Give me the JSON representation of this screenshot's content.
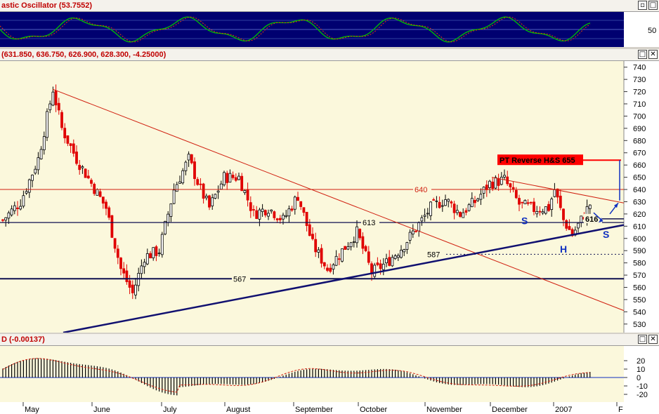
{
  "panels": {
    "stochastic": {
      "title": "astic Oscillator (53.7552)",
      "axis_label": "50"
    },
    "price": {
      "title": "(631.850, 636.750, 626.900, 628.300, -4.25000)"
    },
    "macd": {
      "title": "D (-0.00137)"
    }
  },
  "window_buttons": {
    "minimize": "▫",
    "maximize": "□",
    "close": "✕"
  },
  "chart_data": {
    "type": "candlestick",
    "price_axis": {
      "ylim": [
        523,
        745
      ],
      "ticks": [
        530,
        540,
        550,
        560,
        570,
        580,
        590,
        600,
        610,
        620,
        630,
        640,
        650,
        660,
        670,
        680,
        690,
        700,
        710,
        720,
        730,
        740
      ]
    },
    "months": [
      "May",
      "June",
      "July",
      "August",
      "September",
      "October",
      "November",
      "December",
      "2007",
      "F"
    ],
    "horizontal_levels": [
      {
        "label": "640",
        "value": 640,
        "color": "#d02010"
      },
      {
        "label": "613",
        "value": 613,
        "color": "#101050"
      },
      {
        "label": "567",
        "value": 567,
        "color": "#101050"
      },
      {
        "label": "587",
        "value": 587,
        "color": "#101050",
        "style": "dotted"
      },
      {
        "label": "616",
        "value": 616,
        "color": "#101050"
      }
    ],
    "annotations": [
      {
        "text": "PT Reverse H&S 655",
        "target": 664,
        "color": "#ff0000"
      },
      {
        "text": "S",
        "color": "#1030c0"
      },
      {
        "text": "H",
        "color": "#1030c0"
      },
      {
        "text": "S",
        "color": "#1030c0"
      }
    ],
    "trend_lines": [
      {
        "name": "descending resistance",
        "color": "#d02010"
      },
      {
        "name": "ascending support",
        "color": "#101070"
      },
      {
        "name": "neckline",
        "color": "#d02010"
      }
    ],
    "stochastic_axis": {
      "ticks": [
        50
      ]
    },
    "macd_axis": {
      "ticks": [
        20,
        10,
        0,
        -10,
        -20
      ]
    }
  }
}
